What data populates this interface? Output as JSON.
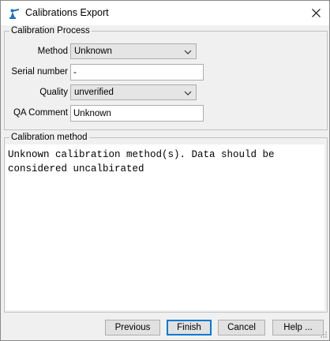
{
  "window": {
    "title": "Calibrations Export",
    "app_icon": "crane-app-icon",
    "close_icon": "close-icon"
  },
  "process": {
    "legend": "Calibration Process",
    "method_label": "Method",
    "method_value": "Unknown",
    "serial_label": "Serial number",
    "serial_value": "-",
    "quality_label": "Quality",
    "quality_value": "unverified",
    "qa_label": "QA Comment",
    "qa_value": "Unknown"
  },
  "method": {
    "legend": "Calibration method",
    "text": "Unknown calibration method(s). Data should be\nconsidered uncalbirated"
  },
  "buttons": {
    "previous": "Previous",
    "finish": "Finish",
    "cancel": "Cancel",
    "help": "Help ..."
  },
  "colors": {
    "accent": "#0078d7",
    "icon_blue": "#1e6fbf"
  }
}
